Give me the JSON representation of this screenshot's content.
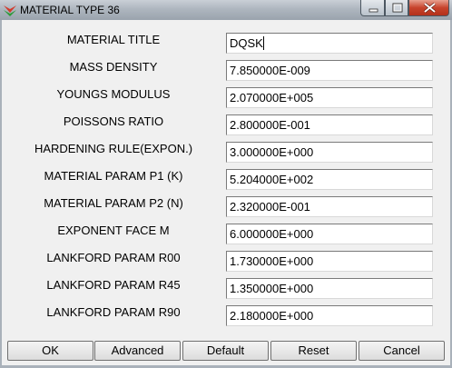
{
  "window": {
    "title": "MATERIAL TYPE 36",
    "icon": "app-logo-icon",
    "controls": [
      "minimize-icon",
      "maximize-icon",
      "close-icon"
    ]
  },
  "fields": [
    {
      "label": "MATERIAL TITLE",
      "value": "DQSK"
    },
    {
      "label": "MASS DENSITY",
      "value": "7.850000E-009"
    },
    {
      "label": "YOUNGS MODULUS",
      "value": "2.070000E+005"
    },
    {
      "label": "POISSONS RATIO",
      "value": "2.800000E-001"
    },
    {
      "label": "HARDENING RULE(EXPON.)",
      "value": "3.000000E+000"
    },
    {
      "label": "MATERIAL PARAM P1 (K)",
      "value": "5.204000E+002"
    },
    {
      "label": "MATERIAL PARAM P2 (N)",
      "value": "2.320000E-001"
    },
    {
      "label": "EXPONENT FACE M",
      "value": "6.000000E+000"
    },
    {
      "label": "LANKFORD PARAM R00",
      "value": "1.730000E+000"
    },
    {
      "label": "LANKFORD PARAM R45",
      "value": "1.350000E+000"
    },
    {
      "label": "LANKFORD PARAM R90",
      "value": "2.180000E+000"
    }
  ],
  "buttons": {
    "ok": "OK",
    "advanced": "Advanced",
    "default": "Default",
    "reset": "Reset",
    "cancel": "Cancel"
  }
}
